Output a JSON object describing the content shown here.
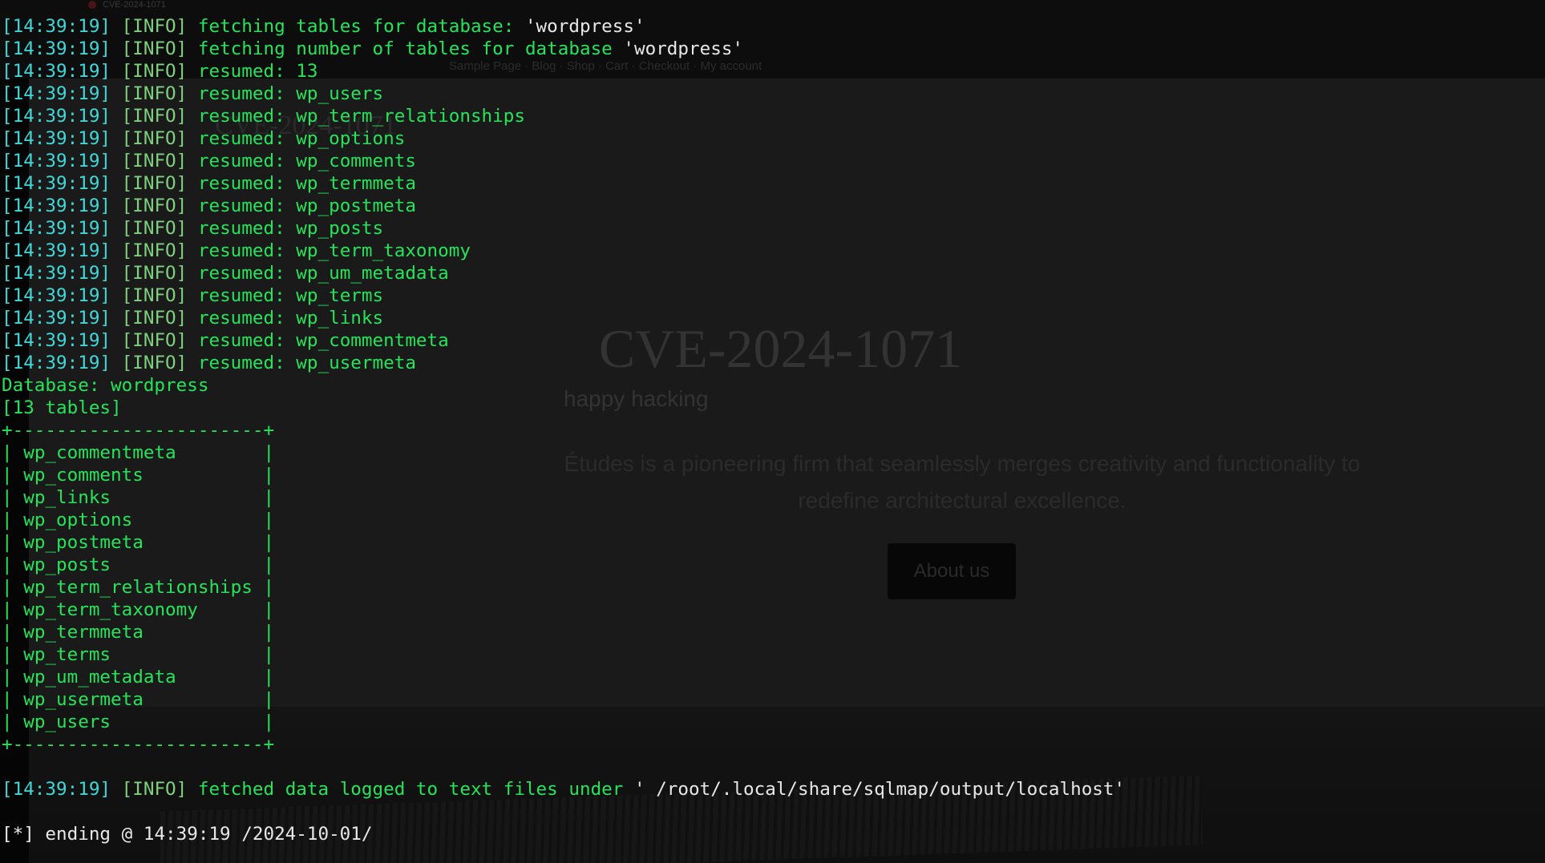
{
  "background_page": {
    "tab_title": "CVE-2024-1071",
    "nav_links": "Sample Page · Blog · Shop · Cart · Checkout · My account",
    "site_name": "CVE-2024-1071",
    "hero_title": "CVE-2024-1071",
    "tagline": "happy hacking",
    "description": "Études is a pioneering firm that seamlessly merges creativity and functionality to redefine architectural excellence.",
    "about_button": "About us"
  },
  "terminal": {
    "timestamp": "[14:39:19]",
    "level": "[INFO]",
    "log_lines": [
      {
        "msg": "fetching tables for database: ",
        "quoted": "'wordpress'"
      },
      {
        "msg": "fetching number of tables for database ",
        "quoted": "'wordpress'"
      },
      {
        "msg": "resumed: 13",
        "quoted": ""
      },
      {
        "msg": "resumed: wp_users",
        "quoted": ""
      },
      {
        "msg": "resumed: wp_term_relationships",
        "quoted": ""
      },
      {
        "msg": "resumed: wp_options",
        "quoted": ""
      },
      {
        "msg": "resumed: wp_comments",
        "quoted": ""
      },
      {
        "msg": "resumed: wp_termmeta",
        "quoted": ""
      },
      {
        "msg": "resumed: wp_postmeta",
        "quoted": ""
      },
      {
        "msg": "resumed: wp_posts",
        "quoted": ""
      },
      {
        "msg": "resumed: wp_term_taxonomy",
        "quoted": ""
      },
      {
        "msg": "resumed: wp_um_metadata",
        "quoted": ""
      },
      {
        "msg": "resumed: wp_terms",
        "quoted": ""
      },
      {
        "msg": "resumed: wp_links",
        "quoted": ""
      },
      {
        "msg": "resumed: wp_commentmeta",
        "quoted": ""
      },
      {
        "msg": "resumed: wp_usermeta",
        "quoted": ""
      }
    ],
    "database_label": "Database: wordpress",
    "tables_count": "[13 tables]",
    "table_border": "+-----------------------+",
    "tables": [
      "wp_commentmeta",
      "wp_comments",
      "wp_links",
      "wp_options",
      "wp_postmeta",
      "wp_posts",
      "wp_term_relationships",
      "wp_term_taxonomy",
      "wp_termmeta",
      "wp_terms",
      "wp_um_metadata",
      "wp_usermeta",
      "wp_users"
    ],
    "logged_msg": "fetched data logged to text files under ",
    "logged_path": "' /root/.local/share/sqlmap/output/localhost'",
    "ending_prefix": "[*]",
    "ending_text": " ending @ 14:39:19 /2024-10-01/"
  },
  "colors": {
    "timestamp": "#3fd7d7",
    "message": "#27e35a",
    "quoted": "#e8e8e8",
    "background": "#1a1a1a"
  }
}
